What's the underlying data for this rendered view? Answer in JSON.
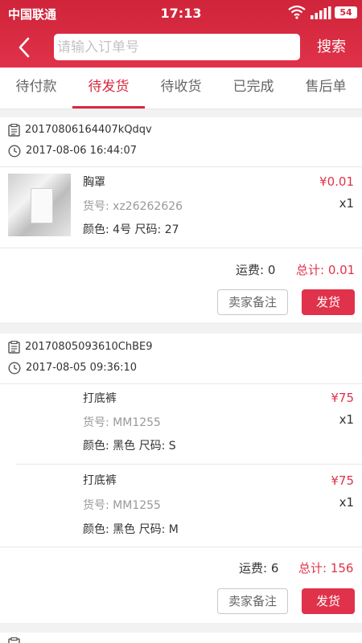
{
  "status_bar": {
    "carrier": "中国联通",
    "time": "17:13",
    "battery": "54"
  },
  "search": {
    "placeholder": "请输入订单号",
    "button_label": "搜索"
  },
  "tabs": [
    {
      "label": "待付款"
    },
    {
      "label": "待发货",
      "active": true
    },
    {
      "label": "待收货"
    },
    {
      "label": "已完成"
    },
    {
      "label": "售后单"
    }
  ],
  "orders": [
    {
      "order_no": "20170806164407kQdqv",
      "time": "2017-08-06 16:44:07",
      "items": [
        {
          "title": "胸罩",
          "sku": "货号: xz26262626",
          "spec": "颜色: 4号 尺码: 27",
          "price": "¥0.01",
          "qty": "x1"
        }
      ],
      "shipping": "运费: 0",
      "total": "总计: 0.01",
      "remark_label": "卖家备注",
      "ship_label": "发货"
    },
    {
      "order_no": "20170805093610ChBE9",
      "time": "2017-08-05 09:36:10",
      "items": [
        {
          "title": "打底裤",
          "sku": "货号: MM1255",
          "spec": "颜色: 黑色 尺码: S",
          "price": "¥75",
          "qty": "x1"
        },
        {
          "title": "打底裤",
          "sku": "货号: MM1255",
          "spec": "颜色: 黑色 尺码: M",
          "price": "¥75",
          "qty": "x1"
        }
      ],
      "shipping": "运费: 6",
      "total": "总计: 156",
      "remark_label": "卖家备注",
      "ship_label": "发货"
    }
  ],
  "colors": {
    "brand": "#e0324a",
    "accent_text": "#d8283d"
  }
}
